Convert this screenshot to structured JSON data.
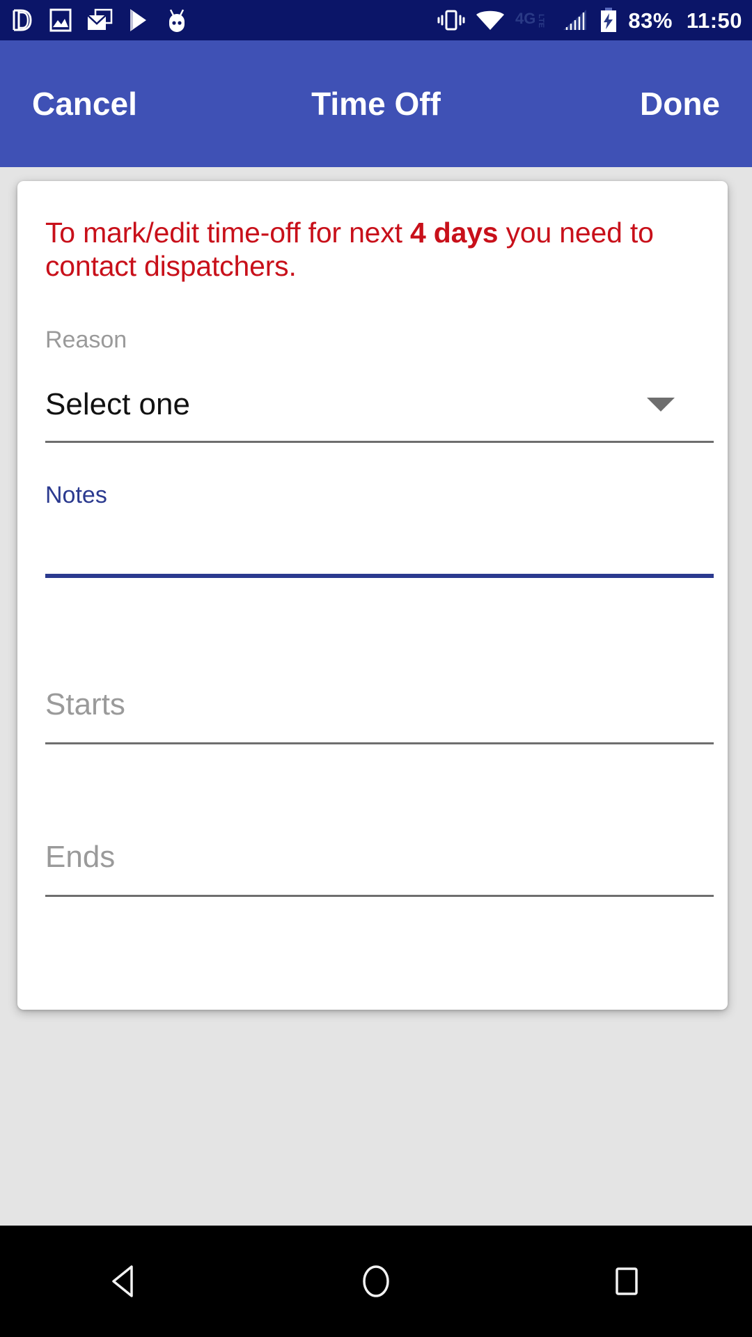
{
  "status_bar": {
    "background_color": "#0b1568",
    "left_icons": [
      {
        "name": "dd-logo-icon",
        "label": "DD"
      },
      {
        "name": "photo-icon",
        "label": "Photos"
      },
      {
        "name": "mail-icon",
        "label": "Mail"
      },
      {
        "name": "play-store-icon",
        "label": "Play Store"
      },
      {
        "name": "android-face-icon",
        "label": "Android"
      }
    ],
    "right_icons": [
      {
        "name": "vibrate-icon",
        "label": "Vibrate"
      },
      {
        "name": "wifi-icon",
        "label": "Wi-Fi"
      },
      {
        "name": "network-4glte-icon",
        "label": "4G LTE"
      },
      {
        "name": "signal-bars-icon",
        "label": "Signal"
      },
      {
        "name": "battery-charging-icon",
        "label": "Charging"
      }
    ],
    "battery_percent": "83%",
    "time": "11:50"
  },
  "app_bar": {
    "background_color": "#3f51b5",
    "cancel_label": "Cancel",
    "title": "Time Off",
    "done_label": "Done"
  },
  "card": {
    "warning": {
      "color": "#c8101a",
      "prefix": "To mark/edit time-off for next ",
      "emphasis": "4 days",
      "suffix": " you need to contact dispatchers."
    },
    "fields": [
      {
        "key": "reason",
        "label": "Reason",
        "value": "Select one",
        "type": "dropdown",
        "focused": false
      },
      {
        "key": "notes",
        "label": "Notes",
        "value": "",
        "placeholder": "",
        "type": "text",
        "focused": true,
        "focus_color": "#2b3a8f"
      },
      {
        "key": "starts",
        "label": "",
        "value": "",
        "placeholder": "Starts",
        "type": "datetime",
        "focused": false
      },
      {
        "key": "ends",
        "label": "",
        "value": "",
        "placeholder": "Ends",
        "type": "datetime",
        "focused": false
      }
    ]
  },
  "nav_bar": {
    "background_color": "#000000",
    "buttons": [
      {
        "name": "nav-back-button",
        "label": "Back"
      },
      {
        "name": "nav-home-button",
        "label": "Home"
      },
      {
        "name": "nav-recents-button",
        "label": "Recents"
      }
    ]
  }
}
